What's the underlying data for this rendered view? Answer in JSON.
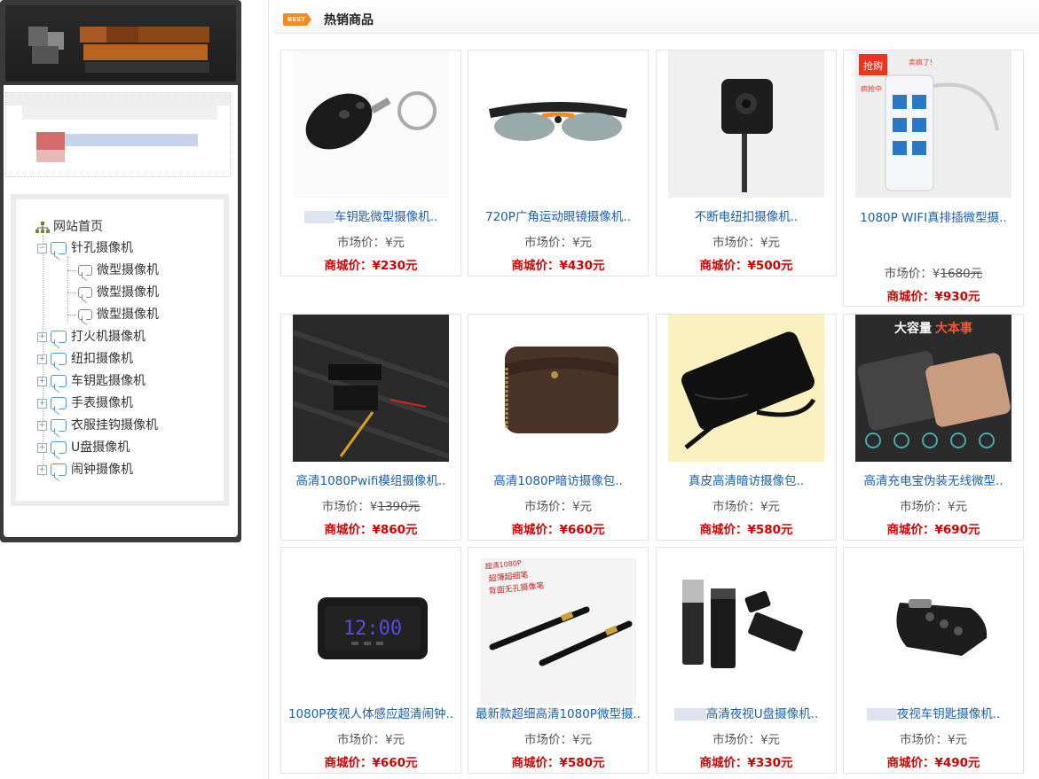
{
  "section": {
    "badge": "BEST",
    "title": "热销商品"
  },
  "tree": {
    "root": "网站首页",
    "items": [
      {
        "label": "针孔摄像机",
        "children": [
          "微型摄像机",
          "微型摄像机",
          "微型摄像机"
        ]
      },
      {
        "label": "打火机摄像机"
      },
      {
        "label": "纽扣摄像机"
      },
      {
        "label": "车钥匙摄像机"
      },
      {
        "label": "手表摄像机"
      },
      {
        "label": "衣服挂钩摄像机"
      },
      {
        "label": "U盘摄像机"
      },
      {
        "label": "闹钟摄像机"
      }
    ]
  },
  "market_label": "市场价：",
  "mall_label": "商城价：",
  "products": [
    {
      "name": "车钥匙微型摄像机..",
      "market": "¥元",
      "market_strike": "",
      "mall": "¥230元",
      "icon": "car-key-camera"
    },
    {
      "name": "720P广角运动眼镜摄像机..",
      "market": "¥元",
      "market_strike": "",
      "mall": "¥430元",
      "icon": "sport-glasses-camera"
    },
    {
      "name": "不断电纽扣摄像机..",
      "market": "¥元",
      "market_strike": "",
      "mall": "¥500元",
      "icon": "button-camera"
    },
    {
      "name": "1080P WIFI真排插微型摄..",
      "market": "¥",
      "market_strike": "1680元",
      "mall": "¥930元",
      "icon": "power-strip-camera"
    },
    {
      "name": "高清1080Pwifi模组摄像机..",
      "market": "¥",
      "market_strike": "1390元",
      "mall": "¥860元",
      "icon": "wifi-module-camera"
    },
    {
      "name": "高清1080P暗访摄像包..",
      "market": "¥元",
      "market_strike": "",
      "mall": "¥660元",
      "icon": "handbag-camera"
    },
    {
      "name": "真皮高清暗访摄像包..",
      "market": "¥元",
      "market_strike": "",
      "mall": "¥580元",
      "icon": "wallet-camera"
    },
    {
      "name": "高清充电宝伪装无线微型..",
      "market": "¥元",
      "market_strike": "",
      "mall": "¥690元",
      "icon": "power-bank-camera"
    },
    {
      "name": "1080P夜视人体感应超清闹钟..",
      "market": "¥元",
      "market_strike": "",
      "mall": "¥660元",
      "icon": "alarm-clock-camera"
    },
    {
      "name": "最新款超细高清1080P微型摄..",
      "market": "¥元",
      "market_strike": "",
      "mall": "¥580元",
      "icon": "pen-camera"
    },
    {
      "name": "高清夜视U盘摄像机..",
      "market": "¥元",
      "market_strike": "",
      "mall": "¥330元",
      "icon": "usb-camera"
    },
    {
      "name": "夜视车钥匙摄像机..",
      "market": "¥元",
      "market_strike": "",
      "mall": "¥490元",
      "icon": "car-key-camera-2"
    }
  ],
  "product_banner_texts": {
    "strip_tag1": "抢购",
    "strip_tag2": "卖疯了!",
    "strip_tag3": "疯抢中",
    "bank_title": "大容量",
    "bank_title2": "大本事",
    "clock_time": "12:00",
    "pen_caption1": "超清1080P",
    "pen_caption2": "超薄超细笔",
    "pen_caption3": "背面无孔摄像笔"
  }
}
